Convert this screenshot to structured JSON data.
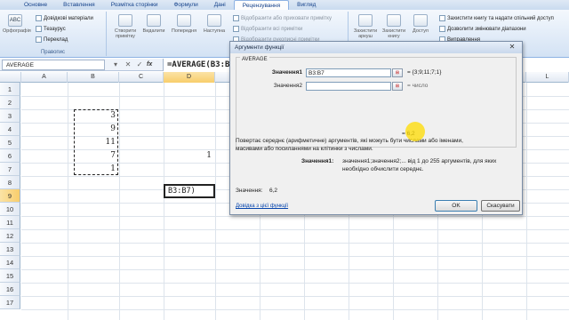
{
  "ribbon": {
    "tabs": [
      "Основне",
      "Вставлення",
      "Розмітка сторінки",
      "Формули",
      "Дані",
      "Рецензування",
      "Вигляд"
    ],
    "active_tab": "Рецензування",
    "proofing": {
      "spelling": "Орфографія",
      "research": "Довідкові матеріали",
      "thesaurus": "Тезаурус",
      "translate": "Переклад",
      "group_label": "Правопис"
    },
    "comments": {
      "new_comment": "Створити примітку",
      "delete": "Видалити",
      "previous": "Попередня",
      "next": "Наступна",
      "show_hide": "Відобразити або приховати примітку",
      "show_all": "Відобразити всі примітки",
      "show_ink": "Відобразити рукописні примітки"
    },
    "changes": {
      "protect_sheet": "Захистити аркуш",
      "protect_book": "Захистити книгу",
      "share": "Доступ",
      "protect_share": "Захистити книгу та надати спільний доступ",
      "allow_edit": "Дозволити змінювати діапазони",
      "track": "Виправлення"
    }
  },
  "formula_bar": {
    "name_box": "AVERAGE",
    "cancel": "✕",
    "enter": "✓",
    "fx": "fx",
    "formula": "=AVERAGE(B3:B7)"
  },
  "sheet": {
    "columns": [
      "A",
      "B",
      "C",
      "D",
      "E",
      "F",
      "G",
      "H",
      "I",
      "J",
      "K",
      "L"
    ],
    "rows": [
      "1",
      "2",
      "3",
      "4",
      "5",
      "6",
      "7",
      "8",
      "9",
      "10",
      "11",
      "12",
      "13",
      "14",
      "15",
      "16",
      "17"
    ],
    "b_values": [
      "3",
      "9",
      "11",
      "7",
      "1"
    ],
    "d6": "1",
    "active_cell_text": "B3:B7)"
  },
  "dialog": {
    "title": "Аргументи функції",
    "function_name": "AVERAGE",
    "arg1_label": "Значення1",
    "arg1_value": "B3:B7",
    "arg1_result": "= {3;9;11;7;1}",
    "arg2_label": "Значення2",
    "arg2_value": "",
    "arg2_result": "= число",
    "result_line": "= 6,2",
    "description": "Повертає середнє (арифметичне) аргументів, які можуть бути числами або іменами, масивами або посиланнями на клітинки з числами.",
    "arg_help_label": "Значення1:",
    "arg_help_text": "значення1;значення2;... від 1 до 255 аргументів, для яких необхідно обчислити середнє.",
    "value_label": "Значення:",
    "value": "6,2",
    "help_link": "Довідка з цієї функції",
    "ok": "OK",
    "cancel": "Скасувати",
    "ref_icon_glyph": "⊞"
  }
}
